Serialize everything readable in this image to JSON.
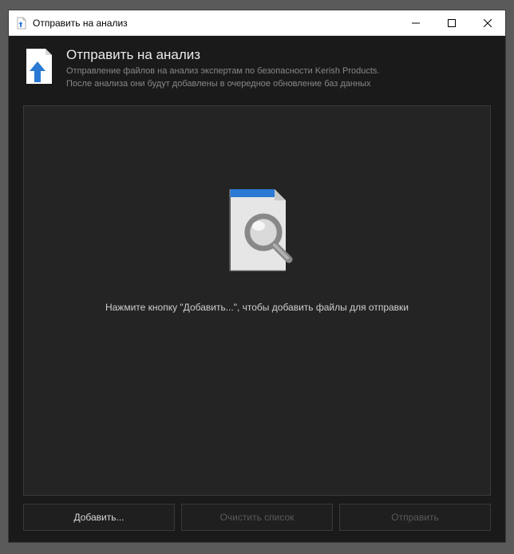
{
  "window": {
    "title": "Отправить на анализ"
  },
  "header": {
    "title": "Отправить на анализ",
    "line1": "Отправление файлов на анализ экспертам по безопасности Kerish Products.",
    "line2": "После анализа они будут добавлены в очередное обновление баз данных"
  },
  "content": {
    "placeholder_text": "Нажмите кнопку \"Добавить...\", чтобы добавить файлы для отправки"
  },
  "footer": {
    "add_label": "Добавить...",
    "clear_label": "Очистить список",
    "send_label": "Отправить"
  }
}
